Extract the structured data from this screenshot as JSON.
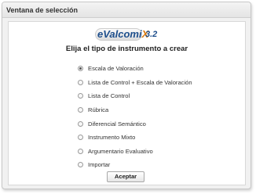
{
  "window": {
    "title": "Ventana de selección"
  },
  "logo": {
    "prefix": "e",
    "middle": "Valcomi",
    "suffix": "X",
    "version": "3.2",
    "colors": {
      "blue": "#1e4f8c",
      "orange": "#d97a10"
    }
  },
  "heading": "Elija el tipo de instrumento a crear",
  "options": [
    {
      "label": "Escala de Valoración",
      "selected": true
    },
    {
      "label": "Lista de Control + Escala de Valoración",
      "selected": false
    },
    {
      "label": "Lista de Control",
      "selected": false
    },
    {
      "label": "Rúbrica",
      "selected": false
    },
    {
      "label": "Diferencial Semántico",
      "selected": false
    },
    {
      "label": "Instrumento Mixto",
      "selected": false
    },
    {
      "label": "Argumentario Evaluativo",
      "selected": false
    },
    {
      "label": "Importar",
      "selected": false
    }
  ],
  "actions": {
    "accept_label": "Aceptar"
  }
}
